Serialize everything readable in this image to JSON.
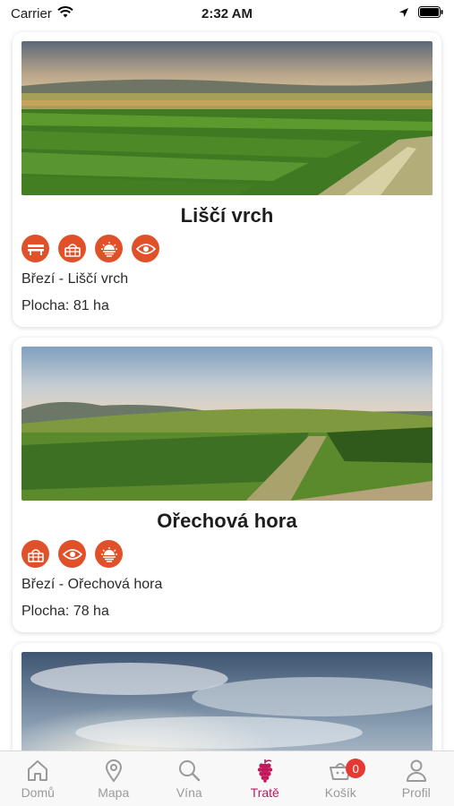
{
  "status_bar": {
    "carrier": "Carrier",
    "time": "2:32 AM"
  },
  "cards": [
    {
      "title": "Liščí vrch",
      "features": [
        "bench-icon",
        "picnic-basket-icon",
        "sunset-icon",
        "eye-icon"
      ],
      "location": "Březí - Liščí vrch",
      "area": "Plocha: 81 ha"
    },
    {
      "title": "Ořechová hora",
      "features": [
        "picnic-basket-icon",
        "eye-icon",
        "sunset-icon"
      ],
      "location": "Březí - Ořechová hora",
      "area": "Plocha: 78 ha"
    }
  ],
  "tabs": [
    {
      "label": "Domů",
      "icon": "home-icon"
    },
    {
      "label": "Mapa",
      "icon": "map-pin-icon"
    },
    {
      "label": "Vína",
      "icon": "search-icon"
    },
    {
      "label": "Tratě",
      "icon": "grapes-icon",
      "active": true
    },
    {
      "label": "Košík",
      "icon": "basket-icon",
      "badge": "0"
    },
    {
      "label": "Profil",
      "icon": "profile-icon"
    }
  ],
  "colors": {
    "accent": "#e0512a",
    "active_tab": "#c2185b",
    "badge": "#e53935"
  }
}
